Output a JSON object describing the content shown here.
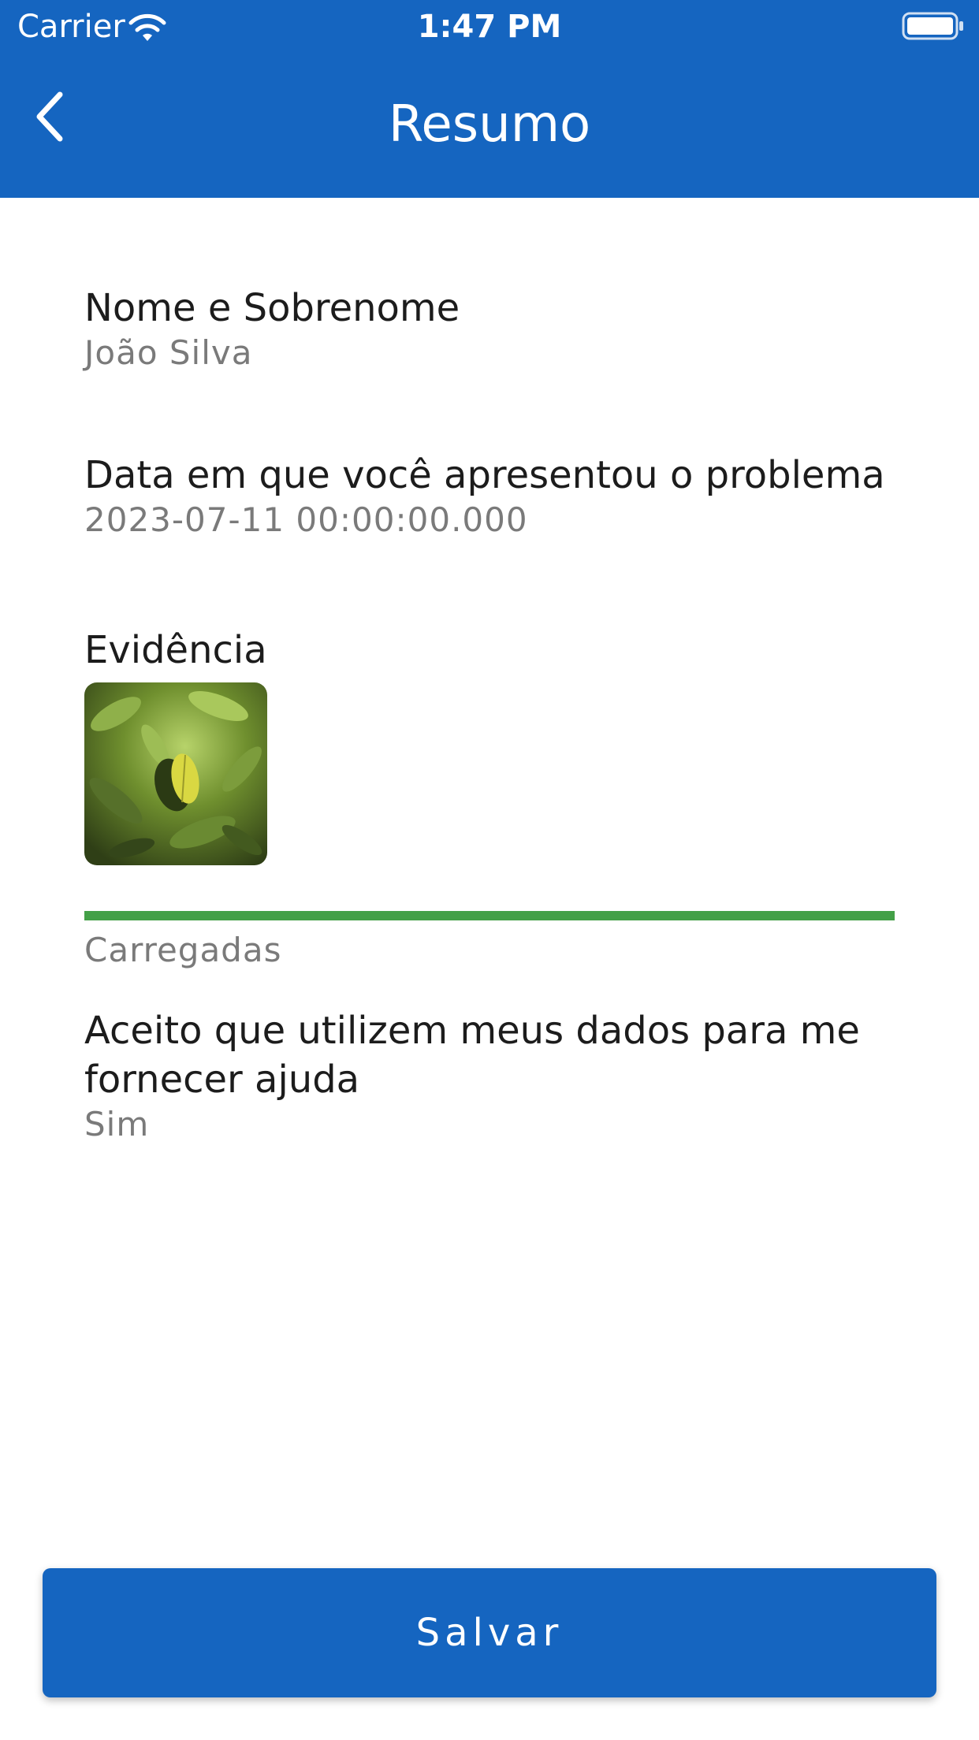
{
  "status_bar": {
    "carrier": "Carrier",
    "time": "1:47 PM"
  },
  "nav": {
    "title": "Resumo",
    "back_icon": "chevron-left-icon"
  },
  "summary": {
    "name": {
      "label": "Nome e Sobrenome",
      "value": "João Silva"
    },
    "date": {
      "label": "Data em que você apresentou o problema",
      "value": "2023-07-11 00:00:00.000"
    },
    "evidence": {
      "label": "Evidência",
      "upload_progress": 1.0,
      "upload_status": "Carregadas"
    },
    "consent": {
      "label": "Aceito que utilizem meus dados para me fornecer ajuda",
      "value": "Sim"
    }
  },
  "actions": {
    "save_label": "Salvar"
  },
  "colors": {
    "primary": "#1565C0",
    "progress": "#43A047",
    "secondary_text": "#7a7a7a"
  }
}
